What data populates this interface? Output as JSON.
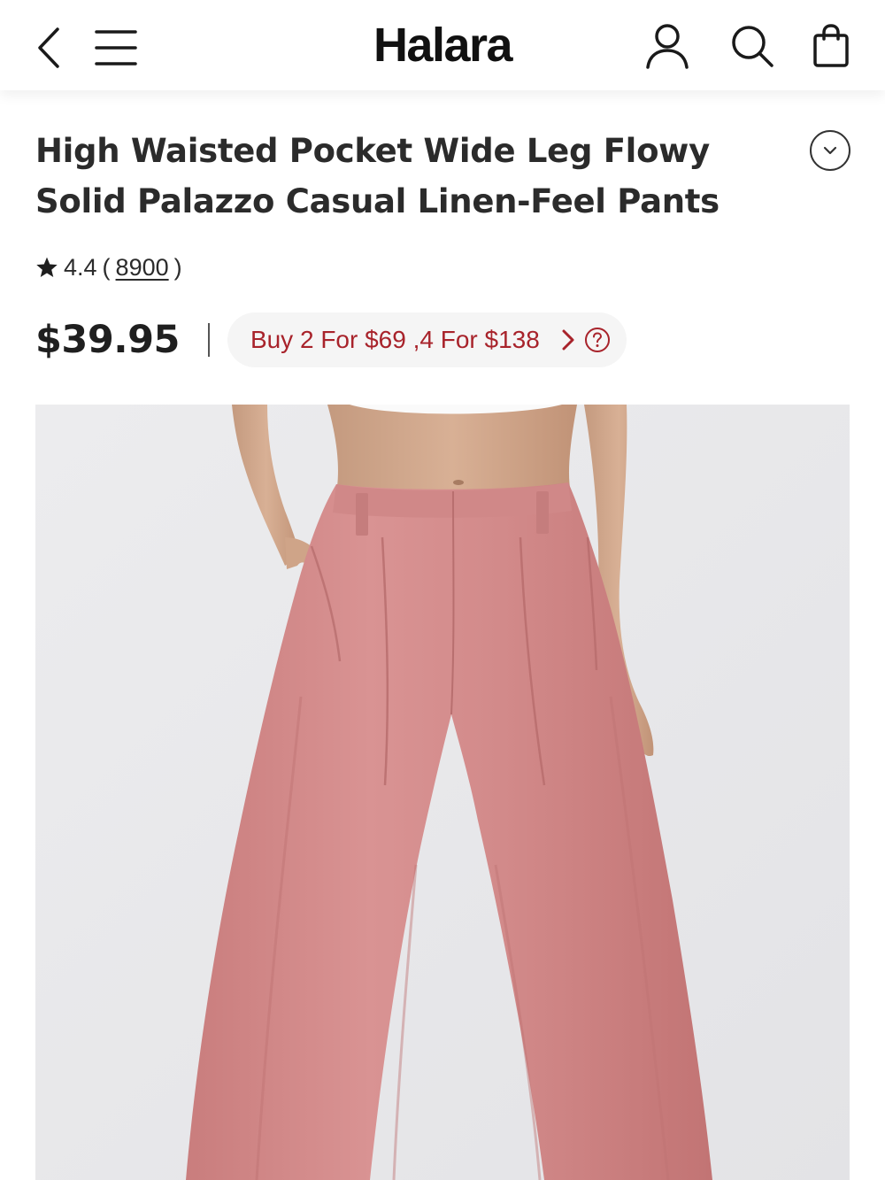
{
  "header": {
    "logo": "Halara",
    "icons": [
      "chevron-left-icon",
      "menu-icon",
      "user-icon",
      "search-icon",
      "shopping-bag-icon"
    ]
  },
  "product": {
    "title_line1": "High Waisted Pocket Wide Leg Flowy",
    "title_line2": "Solid Palazzo Casual Linen-Feel Pants",
    "rating": "4.4",
    "paren_open": "(",
    "review_count": "8900",
    "paren_close": ")",
    "price": "$39.95",
    "promo": "Buy 2 For $69 ,4 For $138"
  },
  "colors": {
    "promo_text": "#a8232b",
    "pants": "#d48a8a",
    "image_background": "#e9e9eb"
  }
}
